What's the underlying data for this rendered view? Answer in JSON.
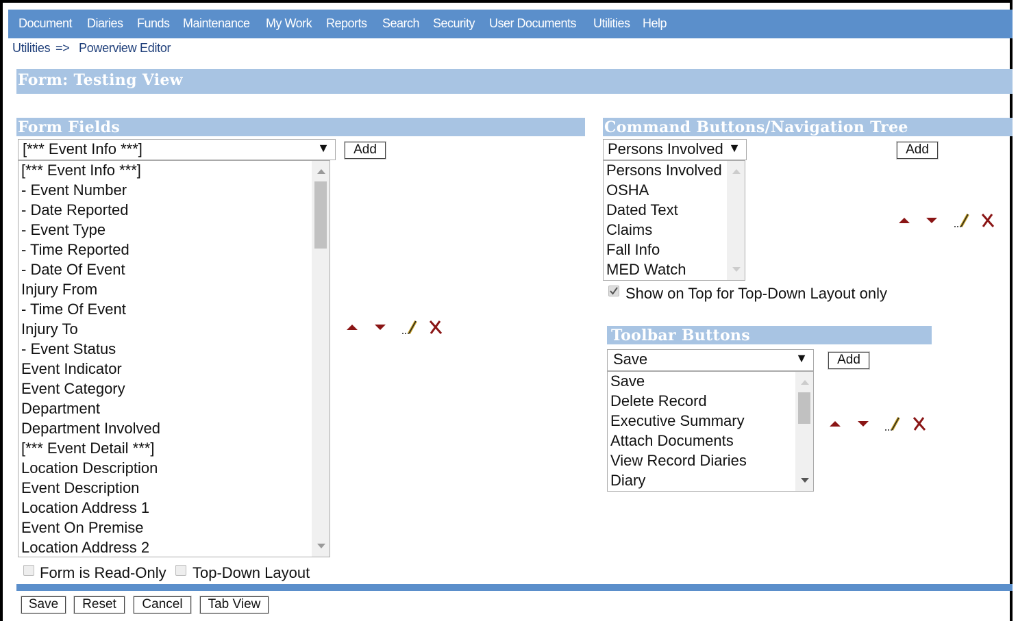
{
  "menu": [
    "Document",
    "Diaries",
    "Funds",
    "Maintenance",
    "My Work",
    "Reports",
    "Search",
    "Security",
    "User Documents",
    "Utilities",
    "Help"
  ],
  "breadcrumb": {
    "parent": "Utilities",
    "sep": "=>",
    "current": "Powerview Editor"
  },
  "form_title": "Form: Testing View",
  "form_fields": {
    "header": "Form Fields",
    "selected": "[*** Event Info ***]",
    "add_label": "Add",
    "items": [
      "[*** Event Info ***]",
      "- Event Number",
      "- Date Reported",
      "- Event Type",
      "- Time Reported",
      "- Date Of Event",
      "Injury From",
      "- Time Of Event",
      "Injury To",
      "- Event Status",
      "Event Indicator",
      "Event Category",
      "Department",
      "Department Involved",
      "[*** Event Detail ***]",
      "Location Description",
      "Event Description",
      "Location Address 1",
      "Event On Premise",
      "Location Address 2"
    ],
    "readonly_label": "Form is Read-Only",
    "topdown_label": "Top-Down Layout",
    "readonly_checked": false,
    "topdown_checked": false
  },
  "command_buttons": {
    "header": "Command Buttons/Navigation Tree",
    "selected": "Persons Involved",
    "add_label": "Add",
    "items": [
      "Persons Involved",
      "OSHA",
      "Dated Text",
      "Claims",
      "Fall Info",
      "MED Watch"
    ],
    "show_on_top_label": "Show on Top for Top-Down Layout only",
    "show_on_top_checked": true
  },
  "toolbar_buttons": {
    "header": "Toolbar Buttons",
    "selected": "Save",
    "add_label": "Add",
    "items": [
      "Save",
      "Delete Record",
      "Executive Summary",
      "Attach Documents",
      "View Record Diaries",
      "Diary"
    ]
  },
  "footer_buttons": {
    "save": "Save",
    "reset": "Reset",
    "cancel": "Cancel",
    "tab_view": "Tab View"
  },
  "icons": {
    "up": "move-up-icon",
    "down": "move-down-icon",
    "edit": "edit-icon",
    "delete": "delete-icon"
  },
  "colors": {
    "menubar": "#5b8fcb",
    "band": "#a8c4e3",
    "icon": "#8a1515"
  }
}
